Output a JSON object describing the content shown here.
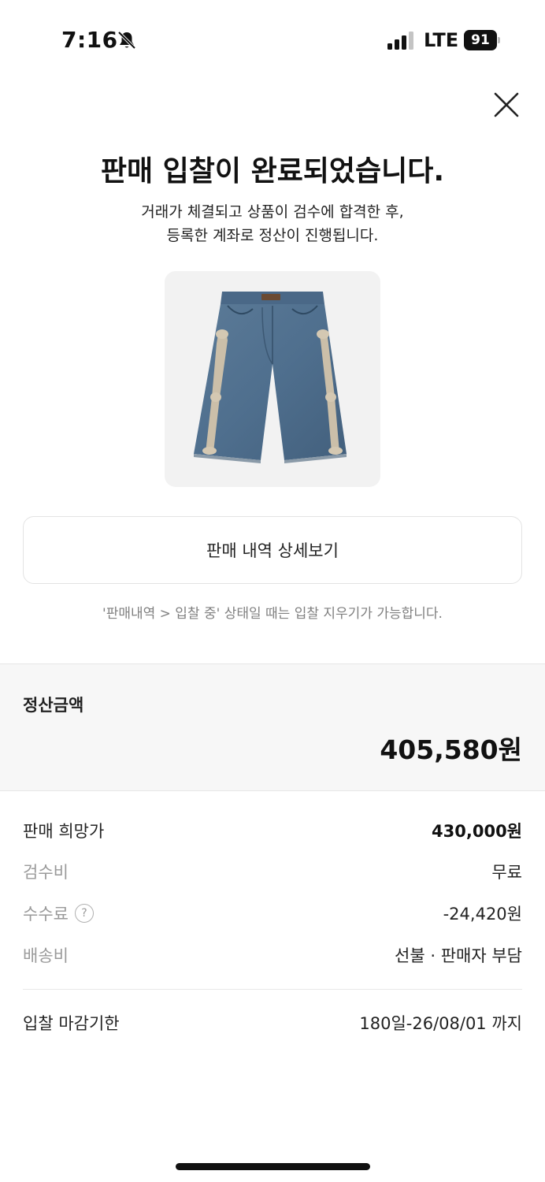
{
  "status_bar": {
    "time": "7:16",
    "network": "LTE",
    "battery_level": "91"
  },
  "header": {
    "title": "판매 입찰이 완료되었습니다.",
    "subtitle_line1": "거래가 체결되고 상품이 검수에 합격한 후,",
    "subtitle_line2": "등록한 계좌로 정산이 진행됩니다."
  },
  "detail_button_label": "판매 내역 상세보기",
  "notice": "'판매내역 > 입찰 중' 상태일 때는 입찰 지우기가 가능합니다.",
  "settlement": {
    "label": "정산금액",
    "amount": "405,580원"
  },
  "fees": {
    "desired_price_label": "판매 희망가",
    "desired_price_value": "430,000원",
    "inspection_label": "검수비",
    "inspection_value": "무료",
    "commission_label": "수수료",
    "commission_value": "-24,420원",
    "shipping_label": "배송비",
    "shipping_value": "선불 · 판매자 부담"
  },
  "deadline": {
    "label": "입찰 마감기한",
    "value": "180일-26/08/01 까지"
  },
  "icons": {
    "bell": "bell-slash-icon",
    "signal": "cellular-signal-icon",
    "close": "close-icon",
    "help": "question-circle-icon"
  },
  "colors": {
    "accent_text": "#111111",
    "muted_text": "#9a9a9a",
    "settlement_background": "#f7f7f7"
  }
}
